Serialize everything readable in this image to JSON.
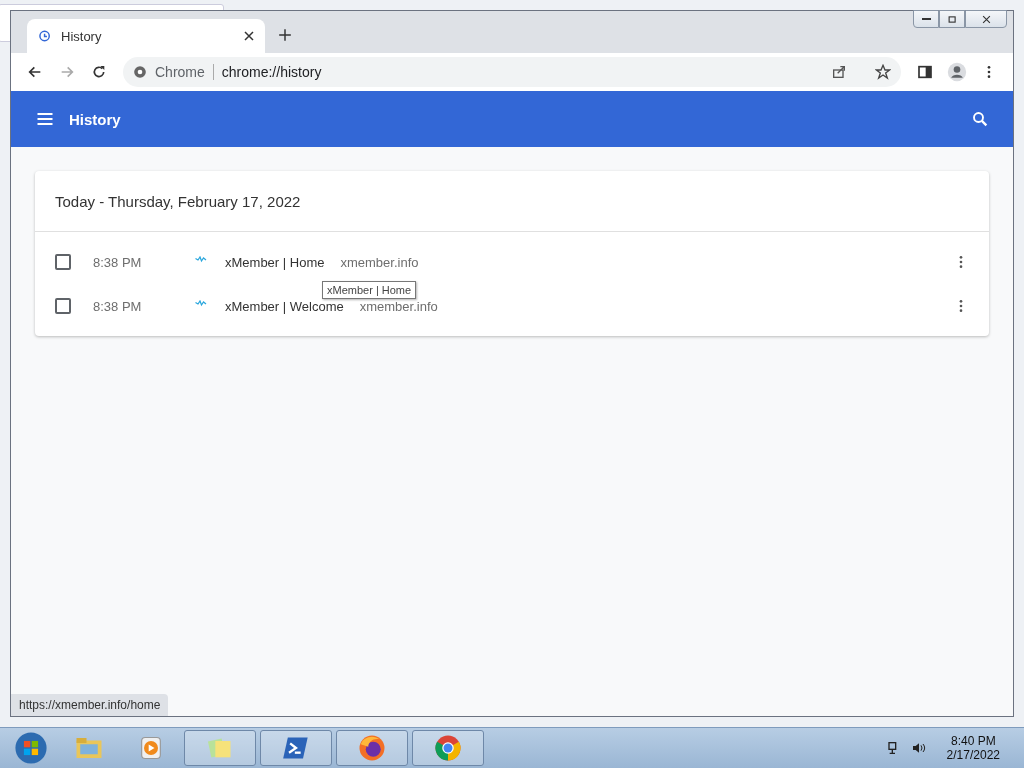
{
  "browser": {
    "tab": {
      "title": "History",
      "selected": true
    },
    "address": {
      "site_label": "Chrome",
      "url": "chrome://history"
    }
  },
  "app_bar": {
    "title": "History"
  },
  "history": {
    "heading": "Today - Thursday, February 17, 2022",
    "entries": [
      {
        "time": "8:38 PM",
        "title": "xMember | Home",
        "domain": "xmember.info",
        "checked": false
      },
      {
        "time": "8:38 PM",
        "title": "xMember | Welcome",
        "domain": "xmember.info",
        "checked": false
      }
    ]
  },
  "tooltip": "xMember | Home",
  "status_url": "https://xmember.info/home",
  "taskbar": {
    "apps": [
      {
        "kind": "folder",
        "running": false
      },
      {
        "kind": "media",
        "running": false
      },
      {
        "kind": "notes",
        "running": true
      },
      {
        "kind": "terminal",
        "running": true
      },
      {
        "kind": "firefox",
        "running": true
      },
      {
        "kind": "chrome",
        "running": true
      }
    ],
    "time": "8:40 PM",
    "date": "2/17/2022"
  }
}
